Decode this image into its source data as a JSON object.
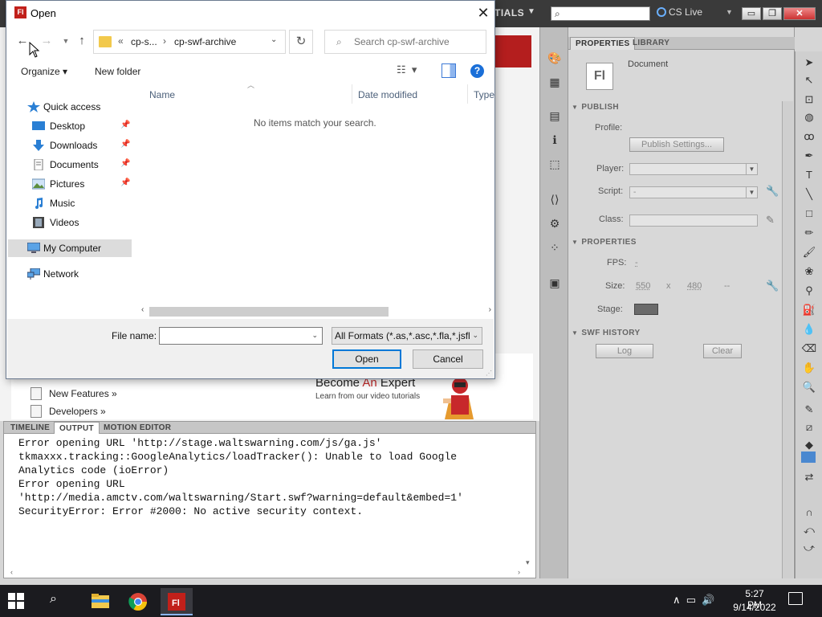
{
  "flash": {
    "workspace_label": "TIALS",
    "cs_live_label": "CS Live",
    "window_buttons": {
      "minimize": "▭",
      "maximize": "❐",
      "close": "✕"
    },
    "properties_panel": {
      "tabs": [
        "PROPERTIES",
        "LIBRARY"
      ],
      "doc_icon_text": "Fl",
      "doc_label": "Document",
      "publish": {
        "header": "PUBLISH",
        "profile_label": "Profile:",
        "publish_settings_label": "Publish Settings...",
        "player_label": "Player:",
        "script_label": "Script:",
        "script_value": "-",
        "class_label": "Class:"
      },
      "properties": {
        "header": "PROPERTIES",
        "fps_label": "FPS:",
        "fps_value": "-",
        "size_label": "Size:",
        "width": "550",
        "x_sep": "x",
        "height": "480",
        "size_unit": "--",
        "stage_label": "Stage:"
      },
      "swf_history": {
        "header": "SWF HISTORY",
        "log_label": "Log",
        "clear_label": "Clear"
      }
    },
    "welcome": {
      "items": [
        "New Features »",
        "Developers »"
      ],
      "become": "Become ",
      "an": "An",
      "expert": " Expert",
      "learn": "Learn from our video tutorials"
    },
    "output_panel": {
      "tabs": [
        "TIMELINE",
        "OUTPUT",
        "MOTION EDITOR"
      ],
      "text": "Error opening URL 'http://stage.waltswarning.com/js/ga.js'\ntkmaxxx.tracking::GoogleAnalytics/loadTracker(): Unable to load Google\nAnalytics code (ioError)\nError opening URL\n'http://media.amctv.com/waltswarning/Start.swf?warning=default&embed=1'\nSecurityError: Error #2000: No active security context."
    }
  },
  "dialog": {
    "title": "Open",
    "icon_text": "Fl",
    "close_glyph": "✕",
    "breadcrumbs": [
      "cp-s...",
      "cp-swf-archive"
    ],
    "crumb_prefix": "«",
    "search_placeholder": "Search cp-swf-archive",
    "toolbar": {
      "organize": "Organize ▾",
      "new_folder": "New folder"
    },
    "nav_items": [
      {
        "label": "Quick access",
        "icon": "star-icon"
      },
      {
        "label": "Desktop",
        "icon": "desktop-icon",
        "pinned": true
      },
      {
        "label": "Downloads",
        "icon": "download-icon",
        "pinned": true
      },
      {
        "label": "Documents",
        "icon": "documents-icon",
        "pinned": true
      },
      {
        "label": "Pictures",
        "icon": "pictures-icon",
        "pinned": true
      },
      {
        "label": "Music",
        "icon": "music-icon"
      },
      {
        "label": "Videos",
        "icon": "videos-icon"
      },
      {
        "label": "My Computer",
        "icon": "computer-icon"
      },
      {
        "label": "Network",
        "icon": "network-icon"
      }
    ],
    "columns": [
      "Name",
      "Date modified",
      "Type"
    ],
    "empty_message": "No items match your search.",
    "file_name_label": "File name:",
    "file_name_value": "",
    "filter_value": "All Formats (*.as,*.asc,*.fla,*.jsfl",
    "open_label": "Open",
    "cancel_label": "Cancel"
  },
  "taskbar": {
    "time": "5:27 PM",
    "date": "9/14/2022",
    "apps": [
      "file-explorer",
      "chrome",
      "flash"
    ],
    "flash_label": "Fl"
  },
  "colors": {
    "accent": "#0078d7",
    "flash_red": "#c1201a",
    "taskbar": "#1b1b1f"
  }
}
